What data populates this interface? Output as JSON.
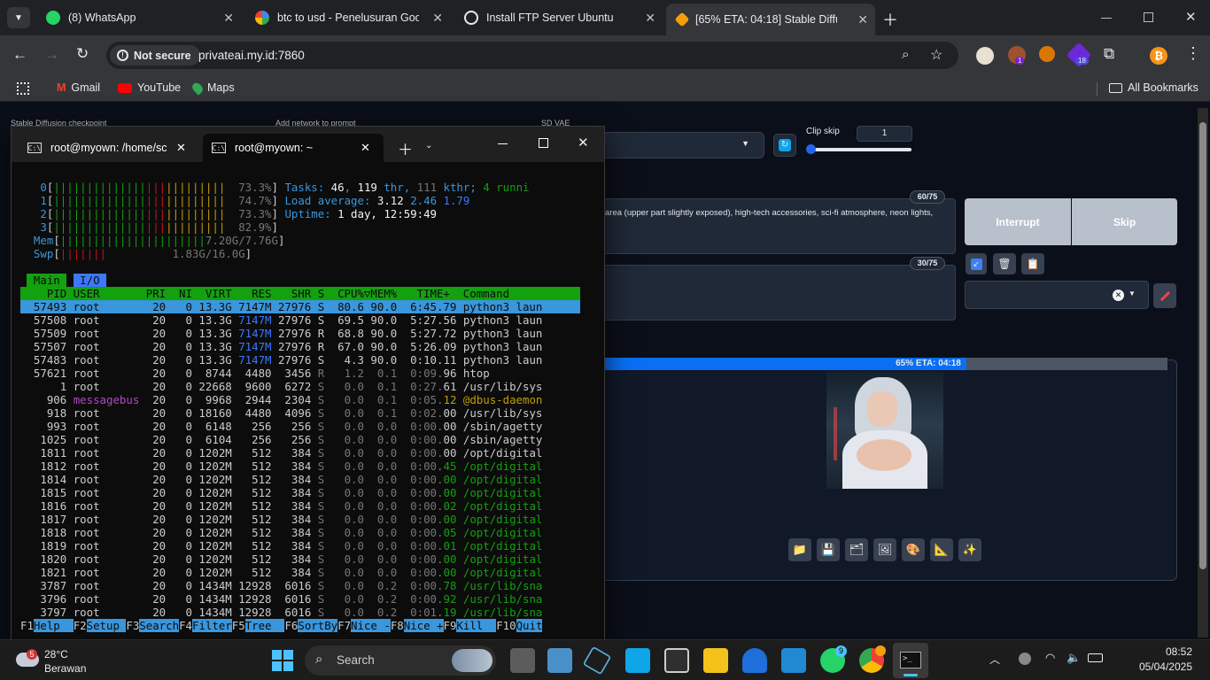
{
  "tabs": [
    {
      "title": "(8) WhatsApp",
      "color": "#25d366"
    },
    {
      "title": "btc to usd - Penelusuran Google",
      "color": "#4285f4"
    },
    {
      "title": "Install FTP Server Ubuntu",
      "color": "#e8eaed"
    },
    {
      "title": "[65% ETA: 04:18] Stable Diffusion",
      "color": "#f59e0b"
    }
  ],
  "omnibox": {
    "security": "Not secure",
    "url": "privateai.my.id:7860"
  },
  "bookmarks": [
    "Gmail",
    "YouTube",
    "Maps"
  ],
  "all_bookmarks": "All Bookmarks",
  "extensions": {
    "badge1": "1",
    "badge18": "18"
  },
  "sd": {
    "labels": {
      "checkpoint": "Stable Diffusion checkpoint",
      "network": "Add network to prompt",
      "vae": "SD VAE",
      "clip": "Clip skip"
    },
    "clip_value": "1",
    "prompt_count": "60/75",
    "prompt_text": "area (upper part slightly exposed), high-tech accessories, sci-fi atmosphere, neon lights,",
    "neg_count": "30/75",
    "interrupt": "Interrupt",
    "skip": "Skip",
    "progress": {
      "text": "65% ETA: 04:18",
      "fraction": 0.65
    }
  },
  "terminal": {
    "tabs": [
      "root@myown: /home/sc",
      "root@myown: ~"
    ],
    "cpus": [
      {
        "n": "0",
        "bar": "||||||||||||||||||||||||||",
        "pct": "73.3%"
      },
      {
        "n": "1",
        "bar": "||||||||||||||||||||||||||",
        "pct": "74.7%"
      },
      {
        "n": "2",
        "bar": "||||||||||||||||||||||||||",
        "pct": "73.3%"
      },
      {
        "n": "3",
        "bar": "||||||||||||||||||||||||||",
        "pct": "82.9%"
      }
    ],
    "mem": "7.20G/7.76G",
    "swp": "1.83G/16.0G",
    "tasks": "46",
    "thr": "119",
    "kthr": "111",
    "running": "4 runni",
    "load": [
      "3.12",
      "2.46",
      "1.79"
    ],
    "uptime": "1 day, 12:59:49",
    "tabs_main": "Main",
    "tabs_io": "I/O",
    "header": "    PID USER       PRI  NI  VIRT   RES   SHR S  CPU%▽MEM%   TIME+  Command",
    "rows": [
      "  57493 root        20   0 13.3G 7147M 27976 S  80.6 90.0  6:45.79 python3 laun",
      "  57508 root        20   0 13.3G 7147M 27976 S  69.5 90.0  5:27.56 python3 laun",
      "  57509 root        20   0 13.3G 7147M 27976 R  68.8 90.0  5:27.72 python3 laun",
      "  57507 root        20   0 13.3G 7147M 27976 R  67.0 90.0  5:26.09 python3 laun",
      "  57483 root        20   0 13.3G 7147M 27976 S   4.3 90.0  0:10.11 python3 laun",
      "  57621 root        20   0  8744  4480  3456 R   1.2  0.1  0:09.96 htop",
      "      1 root        20   0 22668  9600  6272 S   0.0  0.1  0:27.61 /usr/lib/sys",
      "    906 messagebus  20   0  9968  2944  2304 S   0.0  0.1  0:05.12 @dbus-daemon",
      "    918 root        20   0 18160  4480  4096 S   0.0  0.1  0:02.00 /usr/lib/sys",
      "    993 root        20   0  6148   256   256 S   0.0  0.0  0:00.00 /sbin/agetty",
      "   1025 root        20   0  6104   256   256 S   0.0  0.0  0:00.00 /sbin/agetty",
      "   1811 root        20   0 1202M   512   384 S   0.0  0.0  0:00.00 /opt/digital",
      "   1812 root        20   0 1202M   512   384 S   0.0  0.0  0:00.45 /opt/digital",
      "   1814 root        20   0 1202M   512   384 S   0.0  0.0  0:00.00 /opt/digital",
      "   1815 root        20   0 1202M   512   384 S   0.0  0.0  0:00.00 /opt/digital",
      "   1816 root        20   0 1202M   512   384 S   0.0  0.0  0:00.02 /opt/digital",
      "   1817 root        20   0 1202M   512   384 S   0.0  0.0  0:00.00 /opt/digital",
      "   1818 root        20   0 1202M   512   384 S   0.0  0.0  0:00.05 /opt/digital",
      "   1819 root        20   0 1202M   512   384 S   0.0  0.0  0:00.01 /opt/digital",
      "   1820 root        20   0 1202M   512   384 S   0.0  0.0  0:00.00 /opt/digital",
      "   1821 root        20   0 1202M   512   384 S   0.0  0.0  0:00.00 /opt/digital",
      "   3787 root        20   0 1434M 12928  6016 S   0.0  0.2  0:00.78 /usr/lib/sna",
      "   3796 root        20   0 1434M 12928  6016 S   0.0  0.2  0:00.92 /usr/lib/sna",
      "   3797 root        20   0 1434M 12928  6016 S   0.0  0.2  0:01.19 /usr/lib/sna"
    ],
    "fkeys": [
      [
        "F1",
        "Help  "
      ],
      [
        "F2",
        "Setup "
      ],
      [
        "F3",
        "Search"
      ],
      [
        "F4",
        "Filter"
      ],
      [
        "F5",
        "Tree  "
      ],
      [
        "F6",
        "SortBy"
      ],
      [
        "F7",
        "Nice -"
      ],
      [
        "F8",
        "Nice +"
      ],
      [
        "F9",
        "Kill  "
      ],
      [
        "F10",
        "Quit"
      ]
    ]
  },
  "taskbar": {
    "temp": "28°C",
    "weather": "Berawan",
    "weather_badge": "5",
    "search": "Search",
    "time": "08:52",
    "date": "05/04/2025",
    "badge9": "9"
  }
}
